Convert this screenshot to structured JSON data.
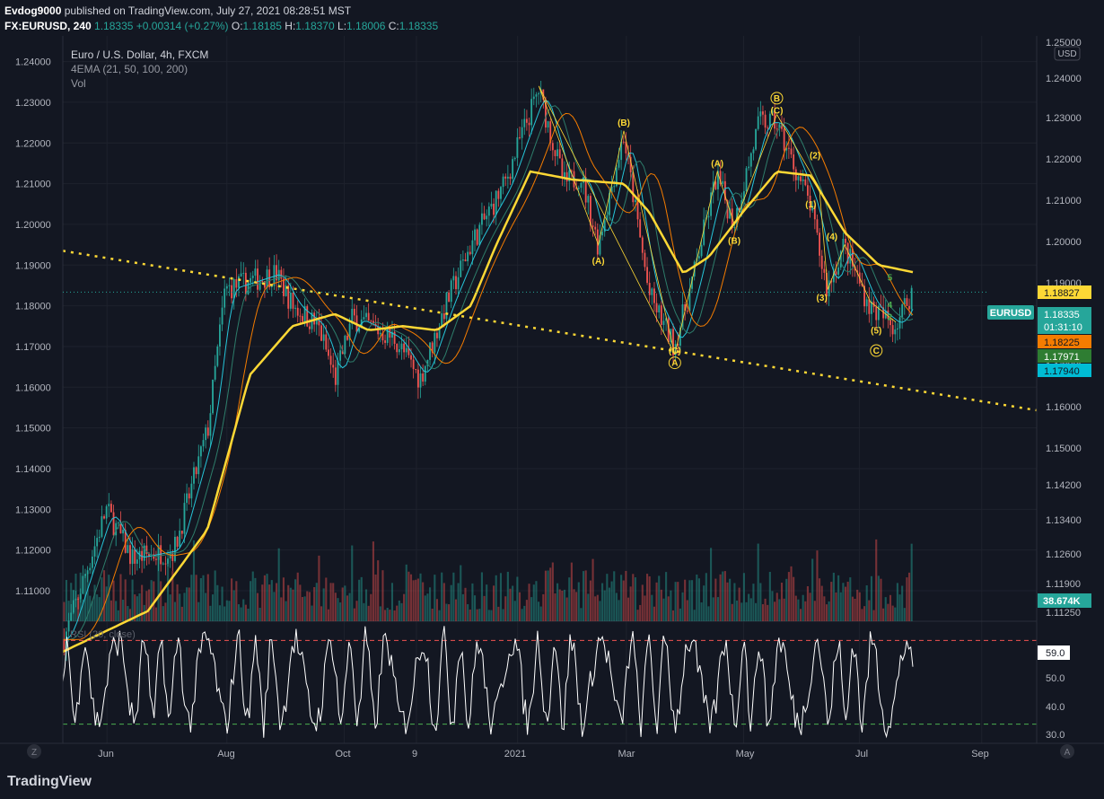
{
  "header": {
    "publisher": "Evdog9000",
    "published_text": "published on TradingView.com, July 27, 2021 08:28:51 MST",
    "symbol": "FX:EURUSD, 240",
    "last": "1.18335",
    "change": "+0.00314 (+0.27%)",
    "open": "1.18185",
    "high": "1.18370",
    "low": "1.18006",
    "close": "1.18335"
  },
  "legend": {
    "title": "Euro / U.S. Dollar, 4h, FXCM",
    "ema": "4EMA (21, 50, 100, 200)",
    "vol": "Vol",
    "rsi": "RSI (20, close)"
  },
  "footer": {
    "logo": "TradingView"
  },
  "colors": {
    "background": "#131722",
    "up": "#26a69a",
    "down": "#ef5350",
    "ema21": "#26c6da",
    "ema50": "#2e7d6b",
    "ema100": "#f57c00",
    "ema200": "#fdd835",
    "wave": "#fdd835",
    "rsi": "#ffffff"
  },
  "chart_data": {
    "type": "candlestick",
    "x_ticks": [
      "Jun",
      "Aug",
      "Oct",
      "9",
      "2021",
      "Mar",
      "May",
      "Jul",
      "Sep"
    ],
    "y_ticks": [
      "1.24000",
      "1.23000",
      "1.22000",
      "1.21000",
      "1.20000",
      "1.19000",
      "1.18000",
      "1.17000",
      "1.16000",
      "1.15000",
      "1.14000",
      "1.13000",
      "1.12000",
      "1.11000"
    ],
    "y_ticks_right": [
      "1.25000",
      "1.24000",
      "1.23000",
      "1.22000",
      "1.21000",
      "1.20000",
      "1.19000",
      "1.18000",
      "1.17000",
      "1.16000",
      "1.15000",
      "1.14200",
      "1.13400",
      "1.12600",
      "1.11900",
      "1.11250"
    ],
    "y_unit": "USD",
    "price_anchors": [
      {
        "t": 0.0,
        "p": 1.098
      },
      {
        "t": 0.05,
        "p": 1.13
      },
      {
        "t": 0.08,
        "p": 1.118
      },
      {
        "t": 0.13,
        "p": 1.12
      },
      {
        "t": 0.17,
        "p": 1.15
      },
      {
        "t": 0.19,
        "p": 1.184
      },
      {
        "t": 0.25,
        "p": 1.188
      },
      {
        "t": 0.27,
        "p": 1.18
      },
      {
        "t": 0.3,
        "p": 1.175
      },
      {
        "t": 0.32,
        "p": 1.162
      },
      {
        "t": 0.34,
        "p": 1.177
      },
      {
        "t": 0.39,
        "p": 1.172
      },
      {
        "t": 0.42,
        "p": 1.162
      },
      {
        "t": 0.45,
        "p": 1.18
      },
      {
        "t": 0.48,
        "p": 1.195
      },
      {
        "t": 0.52,
        "p": 1.21
      },
      {
        "t": 0.54,
        "p": 1.222
      },
      {
        "t": 0.56,
        "p": 1.233
      },
      {
        "t": 0.59,
        "p": 1.21
      },
      {
        "t": 0.61,
        "p": 1.212
      },
      {
        "t": 0.63,
        "p": 1.195
      },
      {
        "t": 0.66,
        "p": 1.222
      },
      {
        "t": 0.69,
        "p": 1.183
      },
      {
        "t": 0.72,
        "p": 1.17
      },
      {
        "t": 0.74,
        "p": 1.185
      },
      {
        "t": 0.77,
        "p": 1.212
      },
      {
        "t": 0.79,
        "p": 1.2
      },
      {
        "t": 0.82,
        "p": 1.225
      },
      {
        "t": 0.84,
        "p": 1.225
      },
      {
        "t": 0.86,
        "p": 1.215
      },
      {
        "t": 0.88,
        "p": 1.205
      },
      {
        "t": 0.9,
        "p": 1.184
      },
      {
        "t": 0.92,
        "p": 1.195
      },
      {
        "t": 0.95,
        "p": 1.18
      },
      {
        "t": 0.98,
        "p": 1.175
      },
      {
        "t": 1.0,
        "p": 1.18335
      }
    ],
    "ema200_anchors": [
      {
        "t": 0.0,
        "p": 1.095
      },
      {
        "t": 0.1,
        "p": 1.105
      },
      {
        "t": 0.17,
        "p": 1.125
      },
      {
        "t": 0.22,
        "p": 1.163
      },
      {
        "t": 0.27,
        "p": 1.175
      },
      {
        "t": 0.32,
        "p": 1.178
      },
      {
        "t": 0.36,
        "p": 1.174
      },
      {
        "t": 0.4,
        "p": 1.175
      },
      {
        "t": 0.44,
        "p": 1.174
      },
      {
        "t": 0.48,
        "p": 1.18
      },
      {
        "t": 0.51,
        "p": 1.195
      },
      {
        "t": 0.55,
        "p": 1.213
      },
      {
        "t": 0.6,
        "p": 1.211
      },
      {
        "t": 0.66,
        "p": 1.21
      },
      {
        "t": 0.69,
        "p": 1.203
      },
      {
        "t": 0.73,
        "p": 1.188
      },
      {
        "t": 0.76,
        "p": 1.192
      },
      {
        "t": 0.8,
        "p": 1.203
      },
      {
        "t": 0.84,
        "p": 1.213
      },
      {
        "t": 0.88,
        "p": 1.212
      },
      {
        "t": 0.92,
        "p": 1.198
      },
      {
        "t": 0.96,
        "p": 1.19
      },
      {
        "t": 1.0,
        "p": 1.18827
      }
    ],
    "trendline": {
      "from": {
        "t": 0.0,
        "p": 1.1935
      },
      "to": {
        "t": 1.17,
        "p": 1.1535
      }
    },
    "wave_lines": [
      {
        "t": 0.56,
        "p": 1.234
      },
      {
        "t": 0.63,
        "p": 1.195
      },
      {
        "t": 0.66,
        "p": 1.223
      },
      {
        "t": 0.72,
        "p": 1.168
      },
      {
        "t": 0.56,
        "p": 1.234
      }
    ],
    "wave_lines_2": [
      {
        "t": 0.72,
        "p": 1.168
      },
      {
        "t": 0.77,
        "p": 1.213
      },
      {
        "t": 0.79,
        "p": 1.2
      },
      {
        "t": 0.84,
        "p": 1.227
      }
    ],
    "wave_lines_3": [
      {
        "t": 0.84,
        "p": 1.227
      },
      {
        "t": 0.89,
        "p": 1.209
      },
      {
        "t": 0.9,
        "p": 1.184
      },
      {
        "t": 0.92,
        "p": 1.195
      },
      {
        "t": 0.95,
        "p": 1.181
      },
      {
        "t": 0.98,
        "p": 1.176
      }
    ],
    "wave_labels": [
      {
        "text": "(A)",
        "t": 0.63,
        "p": 1.191,
        "circled": false
      },
      {
        "text": "(B)",
        "t": 0.66,
        "p": 1.225,
        "circled": false
      },
      {
        "text": "(C)",
        "t": 0.72,
        "p": 1.169,
        "circled": false
      },
      {
        "text": "A",
        "t": 0.72,
        "p": 1.166,
        "circled": true
      },
      {
        "text": "(A)",
        "t": 0.77,
        "p": 1.215,
        "circled": false
      },
      {
        "text": "(B)",
        "t": 0.79,
        "p": 1.196,
        "circled": false
      },
      {
        "text": "(C)",
        "t": 0.84,
        "p": 1.228,
        "circled": false
      },
      {
        "text": "B",
        "t": 0.84,
        "p": 1.231,
        "circled": true
      },
      {
        "text": "(2)",
        "t": 0.885,
        "p": 1.217,
        "circled": false
      },
      {
        "text": "(1)",
        "t": 0.88,
        "p": 1.205,
        "circled": false
      },
      {
        "text": "(4)",
        "t": 0.905,
        "p": 1.197,
        "circled": false
      },
      {
        "text": "(3)",
        "t": 0.893,
        "p": 1.182,
        "circled": false
      },
      {
        "text": "(5)",
        "t": 0.957,
        "p": 1.174,
        "circled": false
      },
      {
        "text": "C",
        "t": 0.957,
        "p": 1.169,
        "circled": true
      }
    ],
    "small_counts": [
      {
        "text": "5",
        "t": 0.97,
        "p": 1.1862
      },
      {
        "text": "4",
        "t": 0.97,
        "p": 1.1795
      },
      {
        "text": "2",
        "t": 0.97,
        "p": 1.1765
      }
    ],
    "price_labels": [
      {
        "text": "1.18827",
        "color": "#fdd835",
        "text_color": "#131722",
        "p": 1.18827
      },
      {
        "text": "1.18335",
        "sub": "01:31:10",
        "color": "#26a69a",
        "text_color": "#ffffff",
        "p": 1.18335
      },
      {
        "text": "1.18225",
        "color": "#f57c00",
        "text_color": "#131722",
        "p": 1.18225
      },
      {
        "text": "1.17971",
        "color": "#2e7d32",
        "text_color": "#ffffff",
        "p": 1.17971
      },
      {
        "text": "1.17940",
        "color": "#00bcd4",
        "text_color": "#131722",
        "p": 1.1794
      }
    ],
    "symbol_tag": "EURUSD",
    "volume_label": "38.674K",
    "rsi": {
      "y_ticks": [
        "59.0",
        "50.0",
        "40.0",
        "30.0"
      ],
      "last": "59.0",
      "upper_band": 70,
      "lower_band": 30
    }
  }
}
